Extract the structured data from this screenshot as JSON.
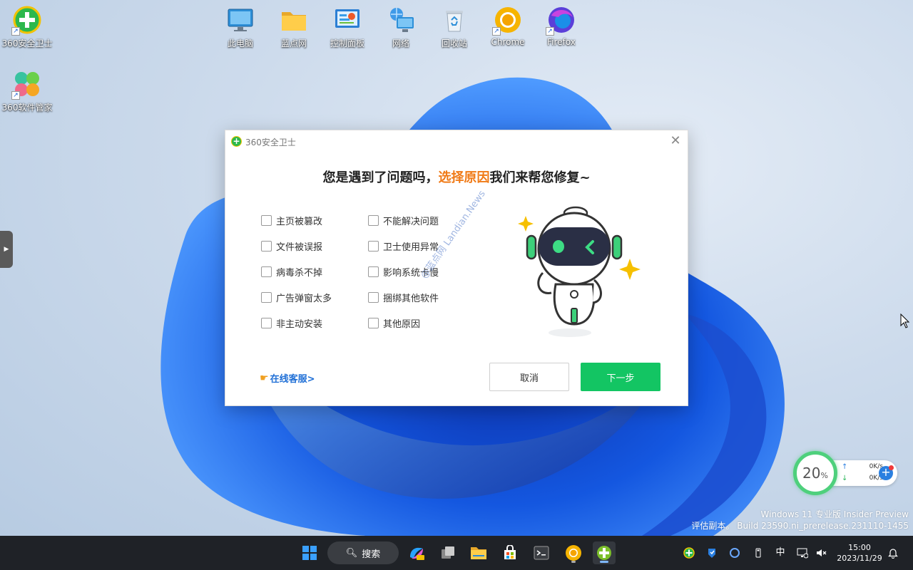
{
  "desktop": {
    "icons": [
      {
        "label": "360安全卫士",
        "icon": "360-safe-icon"
      },
      {
        "label": "此电脑",
        "icon": "computer-icon"
      },
      {
        "label": "蓝点网",
        "icon": "folder-icon"
      },
      {
        "label": "控制面板",
        "icon": "control-panel-icon"
      },
      {
        "label": "网络",
        "icon": "network-icon"
      },
      {
        "label": "回收站",
        "icon": "recycle-bin-icon"
      },
      {
        "label": "Chrome",
        "icon": "chrome-icon"
      },
      {
        "label": "Firefox",
        "icon": "firefox-icon"
      },
      {
        "label": "360软件管家",
        "icon": "360-software-manager-icon"
      }
    ],
    "windows_watermark": {
      "line1": "Windows 11 专业版 Insider Preview",
      "line2": "评估副本。 Build 23590.ni_prerelease.231110-1455"
    }
  },
  "dialog": {
    "app_title": "360安全卫士",
    "headline_prefix": "您是遇到了问题吗，",
    "headline_highlight": "选择原因",
    "headline_suffix": "我们来帮您修复~",
    "options_left": [
      "主页被篡改",
      "文件被误报",
      "病毒杀不掉",
      "广告弹窗太多",
      "非主动安装"
    ],
    "options_right": [
      "不能解决问题",
      "卫士使用异常",
      "影响系统卡慢",
      "捆绑其他软件",
      "其他原因"
    ],
    "online_service": "在线客服>",
    "cancel_label": "取消",
    "next_label": "下一步",
    "watermark": "@蓝点网 Landian.News",
    "accent_color": "#f07a16",
    "primary_color": "#13c563"
  },
  "speed_widget": {
    "percent": "20",
    "percent_unit": "%",
    "upload": "0K/s",
    "download": "0K/s"
  },
  "taskbar": {
    "search_label": "搜索",
    "input_method": "中",
    "time": "15:00",
    "date": "2023/11/29"
  }
}
